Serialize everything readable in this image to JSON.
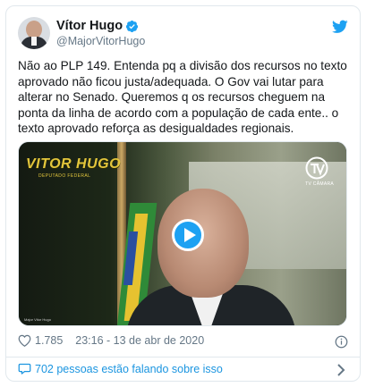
{
  "tweet": {
    "display_name": "Vítor Hugo",
    "handle": "@MajorVitorHugo",
    "text": "Não ao PLP 149. Entenda pq a divisão dos recursos no texto aprovado não ficou justa/adequada. O Gov vai lutar para alterar no Senado. Queremos q os recursos cheguem na ponta da linha de acordo com a população de cada ente.. o texto aprovado reforça as desigualdades regionais.",
    "likes": "1.785",
    "timestamp": "23:16 - 13 de abr de 2020",
    "conversation": "702 pessoas estão falando sobre isso"
  },
  "video": {
    "brand": "VITOR HUGO",
    "brand_sub": "DEPUTADO FEDERAL",
    "tv_label": "TV CÂMARA",
    "caption": "Major Vitor Hugo"
  },
  "icons": {
    "verified": "verified-badge-icon",
    "twitter": "twitter-bird-icon",
    "play": "play-icon",
    "like": "heart-icon",
    "info": "info-icon",
    "conversation": "speech-bubble-icon",
    "chevron": "chevron-right-icon"
  },
  "colors": {
    "accent": "#1da1f2",
    "link": "#1b95e0",
    "muted": "#657786",
    "border": "#e1e8ed"
  }
}
